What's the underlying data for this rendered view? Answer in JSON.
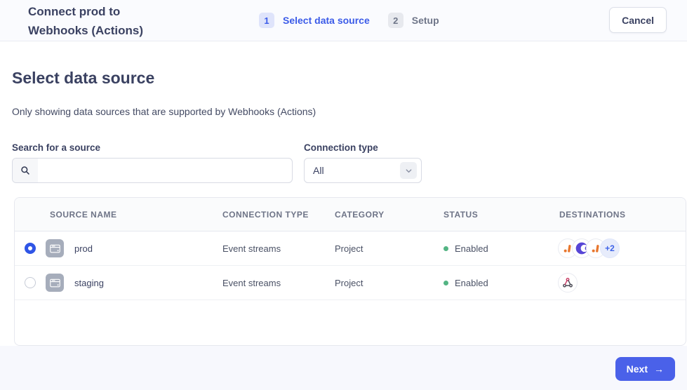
{
  "header": {
    "title": "Connect prod to Webhooks (Actions)",
    "steps": [
      {
        "number": "1",
        "label": "Select data source",
        "active": true
      },
      {
        "number": "2",
        "label": "Setup",
        "active": false
      }
    ],
    "cancel_label": "Cancel"
  },
  "main": {
    "heading": "Select data source",
    "subheading": "Only showing data sources that are supported by Webhooks (Actions)",
    "search": {
      "label": "Search for a source",
      "value": "",
      "placeholder": "",
      "icon": "search-icon"
    },
    "connection_type": {
      "label": "Connection type",
      "selected": "All",
      "icon": "chevron-down-icon"
    }
  },
  "table": {
    "columns": [
      "SOURCE NAME",
      "CONNECTION TYPE",
      "CATEGORY",
      "STATUS",
      "DESTINATIONS"
    ],
    "rows": [
      {
        "name": "prod",
        "connection_type": "Event streams",
        "category": "Project",
        "status": "Enabled",
        "selected": true,
        "source_icon": "browser-source-icon",
        "destination_icons": [
          "analytics-orange-icon",
          "crescent-purple-icon",
          "analytics-orange-icon"
        ],
        "destinations_more": "+2"
      },
      {
        "name": "staging",
        "connection_type": "Event streams",
        "category": "Project",
        "status": "Enabled",
        "selected": false,
        "source_icon": "browser-source-icon",
        "destination_icons": [
          "webhook-icon"
        ],
        "destinations_more": ""
      }
    ]
  },
  "footer": {
    "next_label": "Next",
    "next_arrow": "→"
  },
  "colors": {
    "accent_blue": "#3b5be8",
    "button_blue": "#4a61e9",
    "status_green": "#53b483",
    "step_active_bg": "#dfe4fb",
    "header_bg": "#fafbfe",
    "footer_bg": "#f7f8fd",
    "source_icon_gray": "#a6adbb",
    "webhook_pink": "#c73a63",
    "orange_logo": "#e8772e",
    "purple_logo": "#5746d6"
  }
}
